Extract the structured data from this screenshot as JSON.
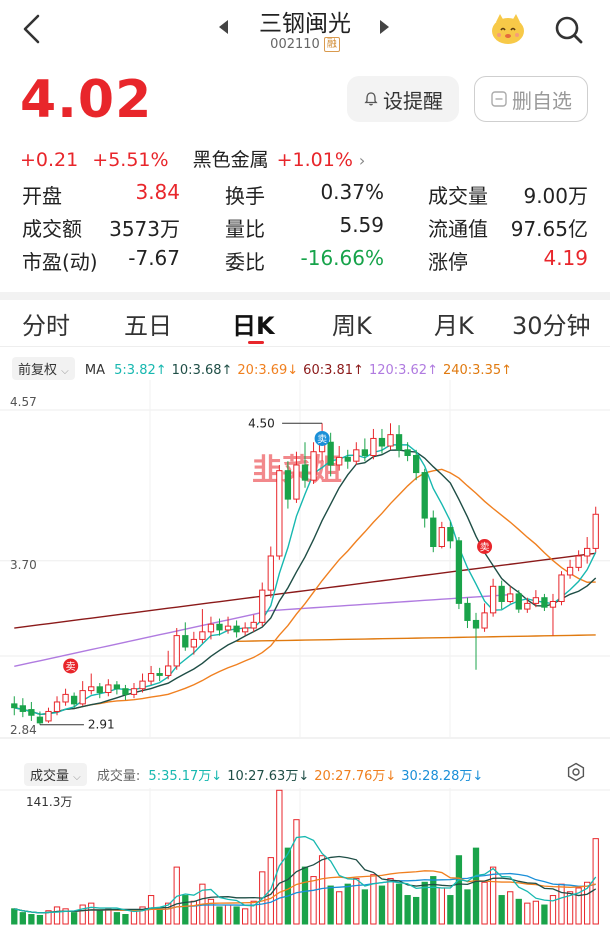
{
  "header": {
    "title": "三钢闽光",
    "code": "002110",
    "margin_badge": "融"
  },
  "quote": {
    "price": "4.02",
    "change": "+0.21",
    "change_pct": "+5.51%",
    "sector_name": "黑色金属",
    "sector_pct": "+1.01%",
    "alert_button": "设提醒",
    "remove_button": "删自选"
  },
  "stats": [
    [
      {
        "label": "开盘",
        "value": "3.84",
        "tone": "red"
      },
      {
        "label": "换手",
        "value": "0.37%",
        "tone": "dark"
      },
      {
        "label": "成交量",
        "value": "9.00万",
        "tone": "dark"
      }
    ],
    [
      {
        "label": "成交额",
        "value": "3573万",
        "tone": "dark"
      },
      {
        "label": "量比",
        "value": "5.59",
        "tone": "dark"
      },
      {
        "label": "流通值",
        "value": "97.65亿",
        "tone": "dark"
      }
    ],
    [
      {
        "label": "市盈(动)",
        "value": "-7.67",
        "tone": "dark"
      },
      {
        "label": "委比",
        "value": "-16.66%",
        "tone": "green"
      },
      {
        "label": "涨停",
        "value": "4.19",
        "tone": "red"
      }
    ]
  ],
  "tabs": [
    "分时",
    "五日",
    "日K",
    "周K",
    "月K",
    "30分钟"
  ],
  "active_tab": "日K",
  "ma_bar": {
    "adjust": "前复权",
    "label": "MA",
    "items": [
      {
        "text": "5:3.82↑",
        "color": "#17b8b0"
      },
      {
        "text": "10:3.68↑",
        "color": "#1f4e46"
      },
      {
        "text": "20:3.69↓",
        "color": "#f08020"
      },
      {
        "text": "60:3.81↑",
        "color": "#8b1a1a"
      },
      {
        "text": "120:3.62↑",
        "color": "#b07be0"
      },
      {
        "text": "240:3.35↑",
        "color": "#e07a10"
      }
    ]
  },
  "chart_data": {
    "type": "candlestick",
    "y_ticks": [
      "4.57",
      "3.70",
      "2.84"
    ],
    "ylim": [
      2.84,
      4.57
    ],
    "max_label": "4.50",
    "min_label": "2.91",
    "sell_marker": "卖",
    "watermark": "韭菜姐",
    "candles": [
      [
        3.02,
        3.0,
        3.06,
        2.96
      ],
      [
        3.01,
        2.98,
        3.05,
        2.95
      ],
      [
        2.99,
        2.96,
        3.03,
        2.93
      ],
      [
        2.95,
        2.92,
        2.98,
        2.91
      ],
      [
        2.93,
        2.98,
        3.0,
        2.92
      ],
      [
        2.98,
        3.03,
        3.06,
        2.96
      ],
      [
        3.03,
        3.07,
        3.1,
        3.01
      ],
      [
        3.06,
        3.02,
        3.08,
        3.0
      ],
      [
        3.02,
        3.09,
        3.14,
        3.01
      ],
      [
        3.09,
        3.11,
        3.18,
        3.07
      ],
      [
        3.11,
        3.08,
        3.13,
        3.05
      ],
      [
        3.08,
        3.12,
        3.15,
        3.06
      ],
      [
        3.12,
        3.1,
        3.14,
        3.07
      ],
      [
        3.1,
        3.07,
        3.12,
        3.04
      ],
      [
        3.07,
        3.1,
        3.13,
        3.05
      ],
      [
        3.1,
        3.14,
        3.18,
        3.08
      ],
      [
        3.14,
        3.18,
        3.22,
        3.12
      ],
      [
        3.18,
        3.17,
        3.21,
        3.14
      ],
      [
        3.17,
        3.22,
        3.3,
        3.15
      ],
      [
        3.22,
        3.38,
        3.42,
        3.2
      ],
      [
        3.38,
        3.32,
        3.45,
        3.3
      ],
      [
        3.32,
        3.36,
        3.4,
        3.28
      ],
      [
        3.36,
        3.4,
        3.52,
        3.34
      ],
      [
        3.4,
        3.44,
        3.48,
        3.36
      ],
      [
        3.44,
        3.41,
        3.47,
        3.38
      ],
      [
        3.41,
        3.43,
        3.48,
        3.39
      ],
      [
        3.43,
        3.4,
        3.46,
        3.37
      ],
      [
        3.4,
        3.42,
        3.45,
        3.38
      ],
      [
        3.42,
        3.45,
        3.49,
        3.4
      ],
      [
        3.45,
        3.62,
        3.66,
        3.43
      ],
      [
        3.62,
        3.8,
        3.85,
        3.58
      ],
      [
        3.8,
        4.25,
        4.28,
        3.78
      ],
      [
        4.25,
        4.1,
        4.3,
        4.05
      ],
      [
        4.1,
        4.28,
        4.35,
        4.08
      ],
      [
        4.28,
        4.2,
        4.4,
        4.16
      ],
      [
        4.2,
        4.35,
        4.4,
        4.18
      ],
      [
        4.35,
        4.4,
        4.5,
        4.3
      ],
      [
        4.4,
        4.28,
        4.45,
        4.22
      ],
      [
        4.28,
        4.32,
        4.38,
        4.25
      ],
      [
        4.32,
        4.3,
        4.36,
        4.26
      ],
      [
        4.3,
        4.36,
        4.4,
        4.28
      ],
      [
        4.36,
        4.33,
        4.42,
        4.3
      ],
      [
        4.33,
        4.42,
        4.47,
        4.31
      ],
      [
        4.42,
        4.38,
        4.47,
        4.34
      ],
      [
        4.38,
        4.44,
        4.5,
        4.36
      ],
      [
        4.44,
        4.36,
        4.49,
        4.32
      ],
      [
        4.36,
        4.33,
        4.4,
        4.3
      ],
      [
        4.33,
        4.24,
        4.36,
        4.2
      ],
      [
        4.24,
        4.0,
        4.26,
        3.95
      ],
      [
        4.0,
        3.85,
        4.04,
        3.82
      ],
      [
        3.85,
        3.95,
        3.98,
        3.84
      ],
      [
        3.95,
        3.88,
        3.98,
        3.84
      ],
      [
        3.88,
        3.55,
        3.9,
        3.52
      ],
      [
        3.55,
        3.46,
        3.58,
        3.42
      ],
      [
        3.46,
        3.42,
        3.5,
        3.2
      ],
      [
        3.42,
        3.5,
        3.55,
        3.4
      ],
      [
        3.5,
        3.64,
        3.68,
        3.48
      ],
      [
        3.64,
        3.56,
        3.67,
        3.52
      ],
      [
        3.56,
        3.6,
        3.64,
        3.55
      ],
      [
        3.6,
        3.52,
        3.62,
        3.5
      ],
      [
        3.52,
        3.55,
        3.58,
        3.5
      ],
      [
        3.55,
        3.58,
        3.62,
        3.53
      ],
      [
        3.58,
        3.53,
        3.6,
        3.51
      ],
      [
        3.53,
        3.56,
        3.6,
        3.38
      ],
      [
        3.56,
        3.7,
        3.72,
        3.54
      ],
      [
        3.7,
        3.74,
        3.78,
        3.68
      ],
      [
        3.74,
        3.8,
        3.83,
        3.72
      ],
      [
        3.8,
        3.84,
        3.9,
        3.76
      ],
      [
        3.84,
        4.02,
        4.06,
        3.82
      ]
    ],
    "volume_label": "成交量",
    "volume_title": "成交量:",
    "volume_ma": [
      {
        "text": "5:35.17万↓",
        "color": "#17b8b0"
      },
      {
        "text": "10:27.63万↓",
        "color": "#1f4e46"
      },
      {
        "text": "20:27.76万↓",
        "color": "#f08020"
      },
      {
        "text": "30:28.28万↓",
        "color": "#1a8fd8"
      }
    ],
    "volume_max_label": "141.3万",
    "volume_max": 141.3,
    "volumes": [
      16,
      12,
      10,
      9,
      14,
      18,
      16,
      12,
      20,
      22,
      14,
      16,
      12,
      10,
      14,
      18,
      30,
      16,
      22,
      60,
      30,
      24,
      42,
      26,
      18,
      20,
      18,
      16,
      24,
      55,
      70,
      141,
      80,
      110,
      60,
      50,
      72,
      40,
      34,
      42,
      48,
      36,
      52,
      40,
      48,
      42,
      30,
      28,
      44,
      50,
      38,
      30,
      72,
      36,
      80,
      44,
      60,
      30,
      34,
      26,
      22,
      24,
      20,
      30,
      42,
      34,
      38,
      44,
      90
    ]
  }
}
